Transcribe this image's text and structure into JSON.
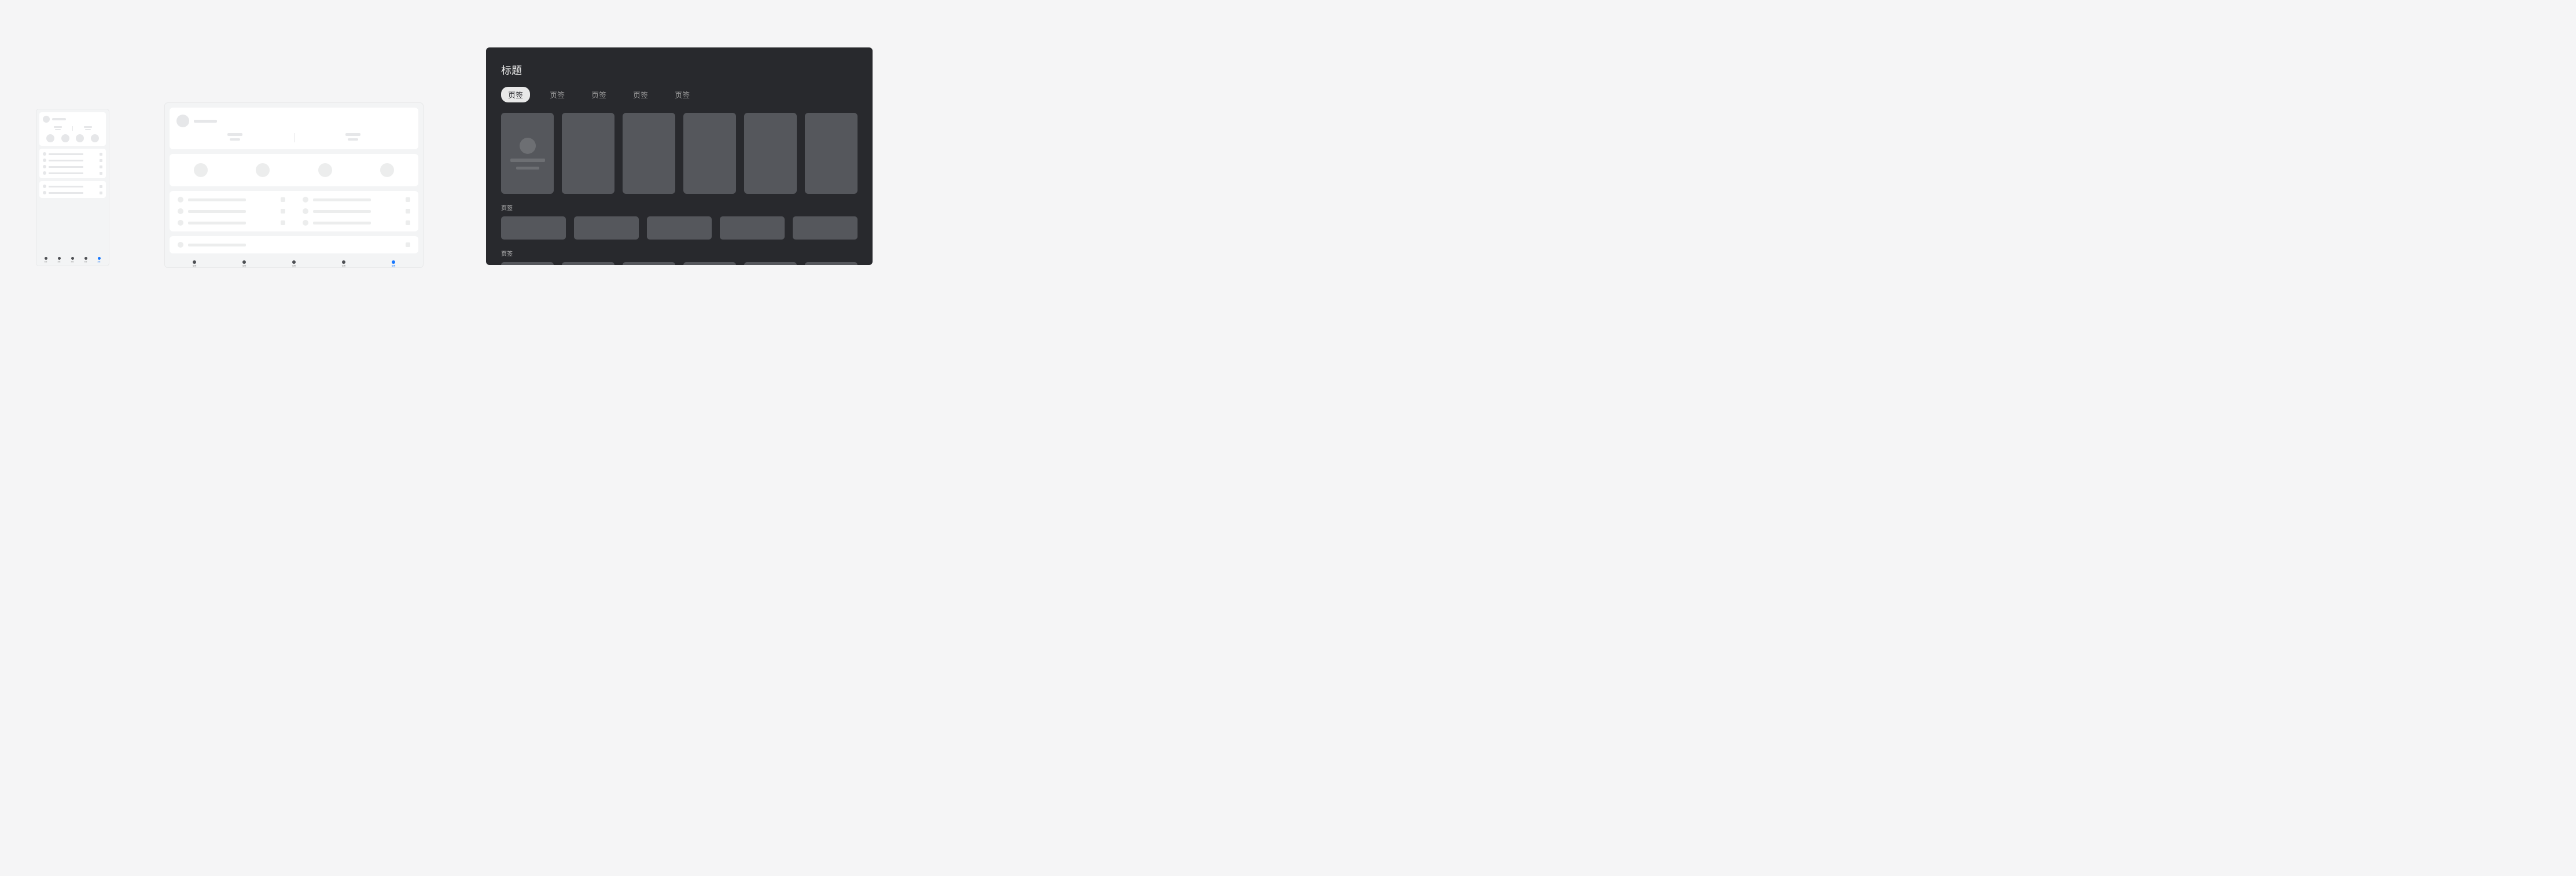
{
  "nav_labels": [
    "页签",
    "页签",
    "页签",
    "页签",
    "页签"
  ],
  "tv": {
    "title": "标题",
    "tabs": [
      "页签",
      "页签",
      "页签",
      "页签",
      "页签"
    ],
    "section_label_1": "页签",
    "section_label_2": "页签"
  }
}
